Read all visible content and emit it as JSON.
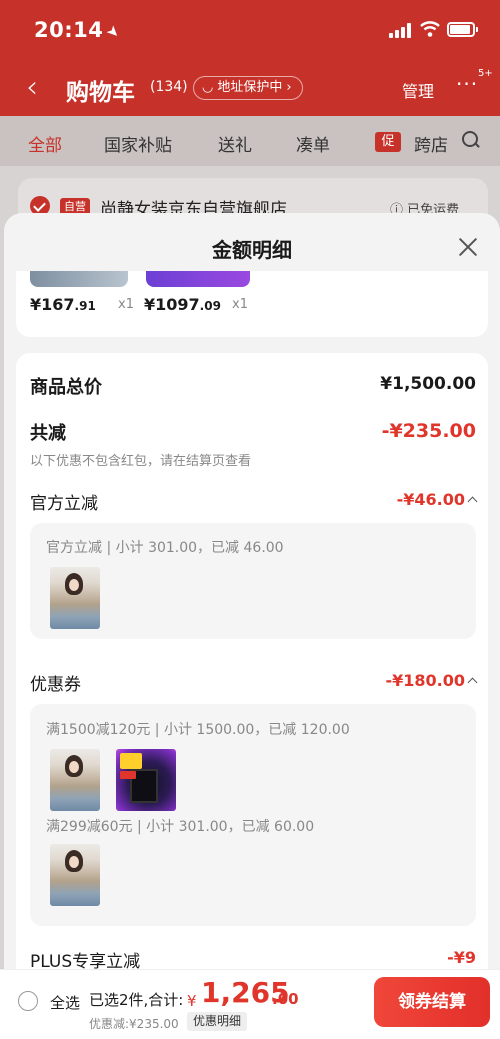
{
  "status_bar": {
    "time": "20:14"
  },
  "nav": {
    "title": "购物车",
    "count": "(134)",
    "address_badge": "地址保护中",
    "manage": "管理",
    "more_badge": "5+"
  },
  "tabs": [
    "全部",
    "国家补贴",
    "送礼",
    "凑单",
    "跨店"
  ],
  "promo_tag": "促",
  "store": {
    "self_tag": "自营",
    "name": "尚静女装京东自营旗舰店",
    "shipping": "已免运费"
  },
  "sheet": {
    "title": "金额明细",
    "products": [
      {
        "price_int": "¥167",
        "price_dec": ".91",
        "qty": "x1"
      },
      {
        "price_int": "¥1097",
        "price_dec": ".09",
        "qty": "x1"
      }
    ],
    "goods_total": {
      "label": "商品总价",
      "value": "¥1,500.00"
    },
    "total_reduction": {
      "label": "共减",
      "value": "-¥235.00",
      "note": "以下优惠不包含红包，请在结算页查看"
    },
    "official": {
      "label": "官方立减",
      "value": "-¥46.00",
      "detail": "官方立减 | 小计 301.00，已减 46.00"
    },
    "coupon": {
      "label": "优惠券",
      "value": "-¥180.00",
      "detail1": "满1500减120元 | 小计 1500.00，已减 120.00",
      "detail2": "满299减60元 | 小计 301.00，已减 60.00"
    },
    "plus": {
      "label": "PLUS专享立减",
      "value": "-¥9"
    }
  },
  "bottom": {
    "select_all": "全选",
    "selected": "已选2件,合计:",
    "currency": "¥",
    "total_int": "1,265",
    "total_dec": ".00",
    "discount": "优惠减:¥235.00",
    "detail": "优惠明细",
    "checkout": "领券结算"
  },
  "colors": {
    "brand_red": "#c6322a",
    "price_red": "#e0352b"
  }
}
